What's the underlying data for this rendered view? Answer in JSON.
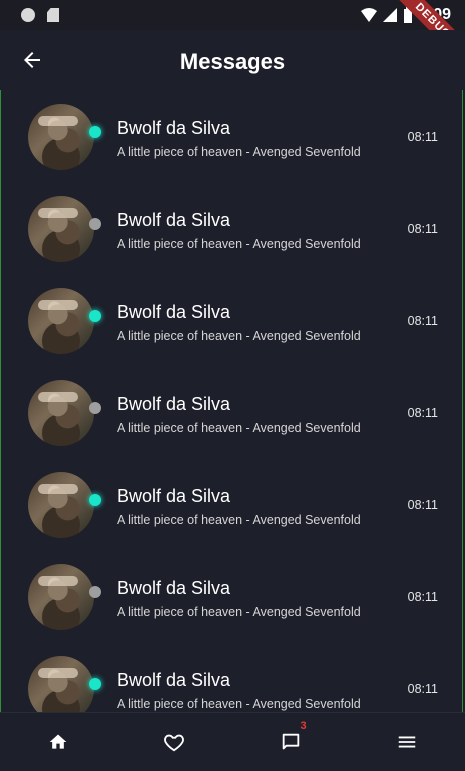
{
  "status_bar": {
    "time": "6:09",
    "debug_label": "DEBUG"
  },
  "app_bar": {
    "title": "Messages",
    "back_icon": "arrow-left-icon"
  },
  "colors": {
    "background": "#1d1f2a",
    "online": "#19e5c9",
    "offline": "#9e9e9e",
    "badge": "#e53935"
  },
  "messages": [
    {
      "name": "Bwolf da Silva",
      "preview": "A little piece of heaven - Avenged Sevenfold",
      "time": "08:11",
      "online": true
    },
    {
      "name": "Bwolf da Silva",
      "preview": "A little piece of heaven - Avenged Sevenfold",
      "time": "08:11",
      "online": false
    },
    {
      "name": "Bwolf da Silva",
      "preview": "A little piece of heaven - Avenged Sevenfold",
      "time": "08:11",
      "online": true
    },
    {
      "name": "Bwolf da Silva",
      "preview": "A little piece of heaven - Avenged Sevenfold",
      "time": "08:11",
      "online": false
    },
    {
      "name": "Bwolf da Silva",
      "preview": "A little piece of heaven - Avenged Sevenfold",
      "time": "08:11",
      "online": true
    },
    {
      "name": "Bwolf da Silva",
      "preview": "A little piece of heaven - Avenged Sevenfold",
      "time": "08:11",
      "online": false
    },
    {
      "name": "Bwolf da Silva",
      "preview": "A little piece of heaven - Avenged Sevenfold",
      "time": "08:11",
      "online": true
    }
  ],
  "bottom_nav": {
    "items": [
      {
        "icon": "home-icon"
      },
      {
        "icon": "heart-icon"
      },
      {
        "icon": "chat-icon",
        "badge": "3"
      },
      {
        "icon": "menu-icon"
      }
    ]
  }
}
